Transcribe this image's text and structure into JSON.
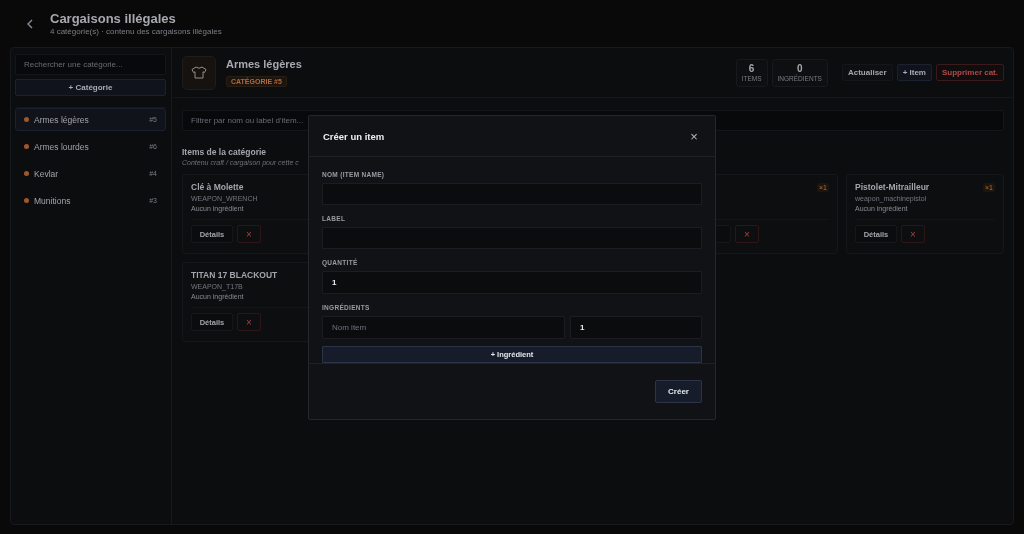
{
  "header": {
    "title": "Cargaisons illégales",
    "subtitle": "4 catégorie(s) · contenu des cargaisons illégales"
  },
  "sidebar": {
    "search_placeholder": "Rechercher une catégorie...",
    "add_button": "+ Catégorie",
    "items": [
      {
        "label": "Armes légères",
        "badge": "#5",
        "selected": true,
        "color": "#a0582a"
      },
      {
        "label": "Armes lourdes",
        "badge": "#6",
        "selected": false,
        "color": "#a0582a"
      },
      {
        "label": "Kevlar",
        "badge": "#4",
        "selected": false,
        "color": "#a0582a"
      },
      {
        "label": "Munitions",
        "badge": "#3",
        "selected": false,
        "color": "#a0582a"
      }
    ]
  },
  "category": {
    "title": "Armes légères",
    "badge": "CATÉGORIE #5",
    "stats": [
      {
        "value": "6",
        "label": "ITEMS"
      },
      {
        "value": "0",
        "label": "INGRÉDIENTS"
      }
    ],
    "buttons": [
      {
        "label": "Actualiser",
        "kind": "plain"
      },
      {
        "label": "+ Item",
        "kind": "primary"
      },
      {
        "label": "Supprimer cat.",
        "kind": "danger"
      }
    ],
    "filter_placeholder": "Filtrer par nom ou label d'item...",
    "section_title": "Items de la catégorie",
    "section_subtitle": "Contenu craft / cargaison pour cette c",
    "items": [
      {
        "kind": "full",
        "name": "Clé à Molette",
        "code": "WEAPON_WRENCH",
        "ingredients": "Aucun ingrédient",
        "details": "Détails",
        "delete": "×"
      },
      {
        "kind": "partial",
        "badge": "×1",
        "delete": "×"
      },
      {
        "kind": "full",
        "name": "Pistolet-Mitrailleur",
        "badge": "×1",
        "code": "weapon_machinepistol",
        "ingredients": "Aucun ingrédient",
        "details": "Détails",
        "delete": "×"
      },
      {
        "kind": "full",
        "name": "TITAN 17 BLACKOUT",
        "code": "WEAPON_T17B",
        "ingredients": "Aucun ingrédient",
        "details": "Détails",
        "delete": "×"
      }
    ]
  },
  "modal": {
    "title": "Créer un item",
    "close": "×",
    "fields": [
      {
        "label": "NOM (ITEM NAME)"
      },
      {
        "label": "LABEL"
      },
      {
        "label": "QUANTITÉ",
        "value": "1"
      }
    ],
    "ingredients_label": "INGRÉDIENTS",
    "ingredients": [
      {
        "name_placeholder": "Nom item",
        "quantity": "1"
      }
    ],
    "add_ingredient": "+ Ingrédient",
    "submit": "Créer"
  }
}
